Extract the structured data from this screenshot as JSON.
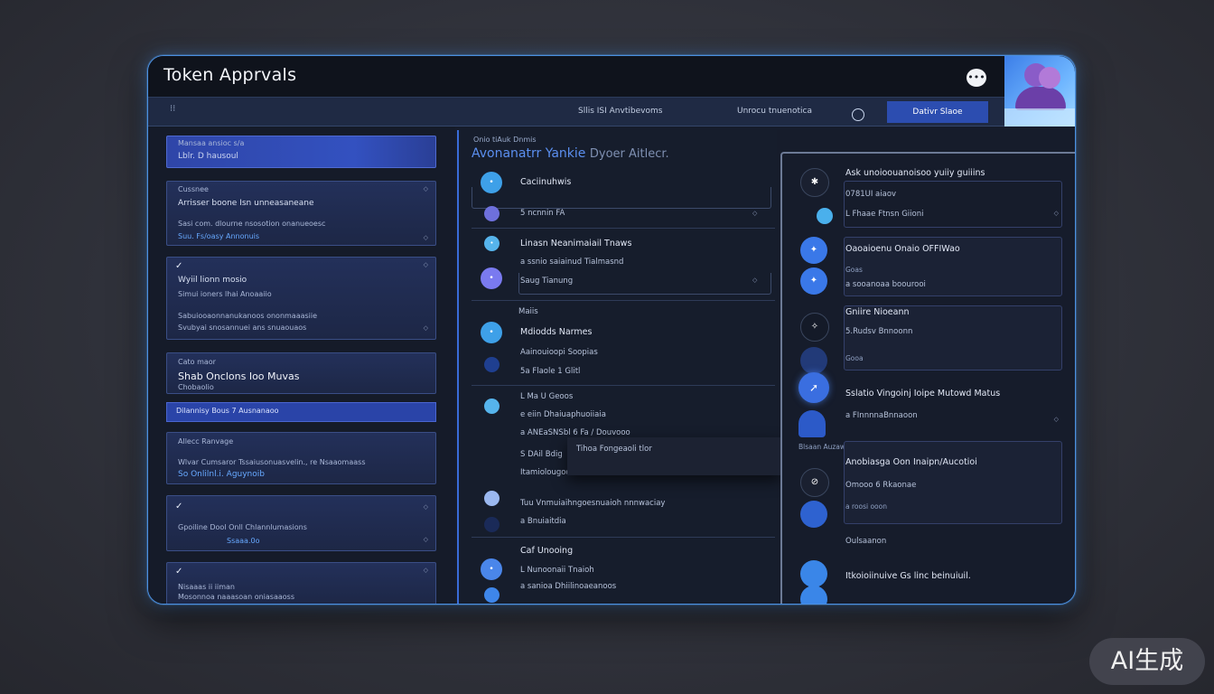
{
  "window": {
    "title": "Token Apprvals"
  },
  "titlebar": {
    "chat_icon": "speech-bubble-icon",
    "avatar": "user-avatar-illustration"
  },
  "toolbar": {
    "menu_label": "⁝⁝",
    "items": [
      "Sllis ISI Anvtibevoms",
      "Unrocu tnuenotica"
    ],
    "active": "Dativr Slaoe"
  },
  "left": {
    "cards": [
      {
        "lines": [
          "Mansaa ansioc s/a",
          "Lblr. D hausoul"
        ]
      },
      {
        "lines": [
          "Cussnee",
          "Arrisser boone Isn unneasaneane",
          "Sasi com. dlourne nsosotion onanueoesc",
          "Suu. Fs/oasy           Annonuis"
        ]
      },
      {
        "lines": [
          "Wyiil lionn mosio",
          "Simui ioners lhai Anoaaiio",
          "Sabuiooaonnanukanoos ononmaaasiie",
          "Svubyai snosannuei ans snuaouaos"
        ]
      },
      {
        "lines": [
          "Cato maor",
          "Shab Onclons Ioo Muvas",
          "Chobaolio"
        ]
      },
      {
        "strip": "Dilannisy                 Bous 7 Ausnanaoo"
      },
      {
        "lines": [
          "Allecc Ranvage",
          "Wlvar Cumsaror Tssaiusonuasvelin., re Nsaaomaass",
          "So  Onlilnl.i.  Aguynoib"
        ]
      },
      {
        "lines": [
          "Gpoiline Dool Onll Chlannlumasions",
          "Ssaaa.0o"
        ]
      },
      {
        "lines": [
          "Nisaaas ii iiman",
          "Mosonnoa naaasoan oniasaaoss"
        ]
      }
    ]
  },
  "middle": {
    "header_small": "Onio tiAuk Dnmis",
    "header_title": "Avonanatrr Yankie",
    "header_title_grey": "Dyoer Aitlecr.",
    "rows": [
      {
        "label": "Caciinuhwis"
      },
      {
        "label": "5 ncnnin FA"
      },
      {
        "label": "Linasn Neanimaiail Tnaws"
      },
      {
        "label": "a ssnio saiainud Tialmasnd"
      },
      {
        "label": "Saug Tianung"
      },
      {
        "label": "Maiis"
      },
      {
        "label": "Mdiodds Narmes"
      },
      {
        "label": "Aainouioopi Soopias"
      },
      {
        "label": "5a Flaole 1 Glitl"
      },
      {
        "label": "L Ma U Geoos"
      },
      {
        "label": "e eiin Dhaiuaphuoiiaia"
      },
      {
        "label": "a  ANEaSNSbl 6 Fa / Douvooo"
      },
      {
        "label": "S DAil Bdig"
      },
      {
        "label": "Itamiolougoo Tnnaaiaanea"
      },
      {
        "label": "Tihoa Fongeaoli tlor"
      },
      {
        "label": "Tuu Vnmuiaihngoesnuaioh nnnwaciay"
      },
      {
        "label": "a Bnuiaitdia"
      },
      {
        "label": "Caf Unooing"
      },
      {
        "label": "L Nunoonaii Tnaioh"
      },
      {
        "label": "a sanioa Dhiilinoaeanoos"
      }
    ]
  },
  "right": {
    "items": [
      {
        "title": "Ask unoioouanoisoo yuiiy guiiins",
        "sub": "0781UI aiaov",
        "line": "L Fhaae Ftnsn Giioni"
      },
      {
        "title": "Oaoaioenu Onaio OFFIWao",
        "sub": "Goas",
        "line": "a sooanoaa boourooi"
      },
      {
        "title": "Gniire Nioeann",
        "sub": "5.Rudsv Bnnoonn",
        "line": "Gooa"
      },
      {
        "title": "Sslatio Vingoinj Ioipe Mutowd Matus",
        "sub": "a FInnnnaBnnaoon",
        "line": ""
      },
      {
        "title": "Anobiasga Oon Inaipn/Aucotioi",
        "sub": "Omooo 6 Rkaonae",
        "line": "a roosi ooon",
        "label": "Blsaan Auzawye"
      },
      {
        "title": "Oulsaanon",
        "sub": "Itkoioiinuive Gs linc beinuiuil.",
        "line": ""
      }
    ]
  },
  "watermark": "AI生成"
}
